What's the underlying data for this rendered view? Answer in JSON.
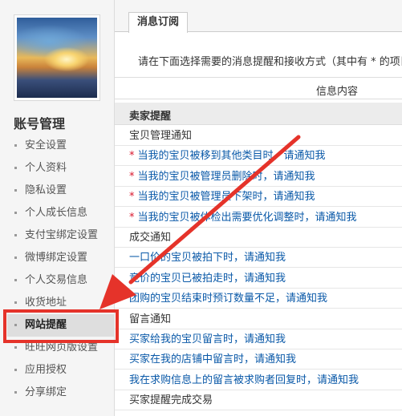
{
  "sidebar": {
    "section_title": "账号管理",
    "items": [
      {
        "label": "安全设置",
        "active": false
      },
      {
        "label": "个人资料",
        "active": false
      },
      {
        "label": "隐私设置",
        "active": false
      },
      {
        "label": "个人成长信息",
        "active": false
      },
      {
        "label": "支付宝绑定设置",
        "active": false
      },
      {
        "label": "微博绑定设置",
        "active": false
      },
      {
        "label": "个人交易信息",
        "active": false
      },
      {
        "label": "收货地址",
        "active": false
      },
      {
        "label": "网站提醒",
        "active": true
      },
      {
        "label": "旺旺网页版设置",
        "active": false
      },
      {
        "label": "应用授权",
        "active": false
      },
      {
        "label": "分享绑定",
        "active": false
      }
    ]
  },
  "content": {
    "tab": "消息订阅",
    "intro": "请在下面选择需要的消息提醒和接收方式（其中有 * 的项目至",
    "table_header": "信息内容",
    "group_title": "卖家提醒",
    "rows": [
      {
        "type": "cat",
        "star": false,
        "text": "宝贝管理通知"
      },
      {
        "type": "item",
        "star": true,
        "text": "当我的宝贝被移到其他类目时，请通知我"
      },
      {
        "type": "item",
        "star": true,
        "text": "当我的宝贝被管理员删除时，请通知我"
      },
      {
        "type": "item",
        "star": true,
        "text": "当我的宝贝被管理员下架时，请通知我"
      },
      {
        "type": "item",
        "star": true,
        "text": "当我的宝贝被体检出需要优化调整时，请通知我"
      },
      {
        "type": "cat",
        "star": false,
        "text": "成交通知"
      },
      {
        "type": "item",
        "star": false,
        "text": "一口价的宝贝被拍下时，请通知我"
      },
      {
        "type": "item",
        "star": false,
        "text": "竞价的宝贝已被拍走时，请通知我"
      },
      {
        "type": "item",
        "star": false,
        "text": "团购的宝贝结束时预订数量不足，请通知我"
      },
      {
        "type": "cat",
        "star": false,
        "text": "留言通知"
      },
      {
        "type": "item",
        "star": false,
        "text": "买家给我的宝贝留言时，请通知我"
      },
      {
        "type": "item",
        "star": false,
        "text": "买家在我的店铺中留言时，请通知我"
      },
      {
        "type": "item",
        "star": false,
        "text": "我在求购信息上的留言被求购者回复时，请通知我"
      },
      {
        "type": "cat",
        "star": false,
        "text": "买家提醒完成交易"
      }
    ],
    "star_symbol": "*"
  },
  "colors": {
    "link": "#0a59a8",
    "star": "#d9162c",
    "annotation": "#e5332a"
  }
}
